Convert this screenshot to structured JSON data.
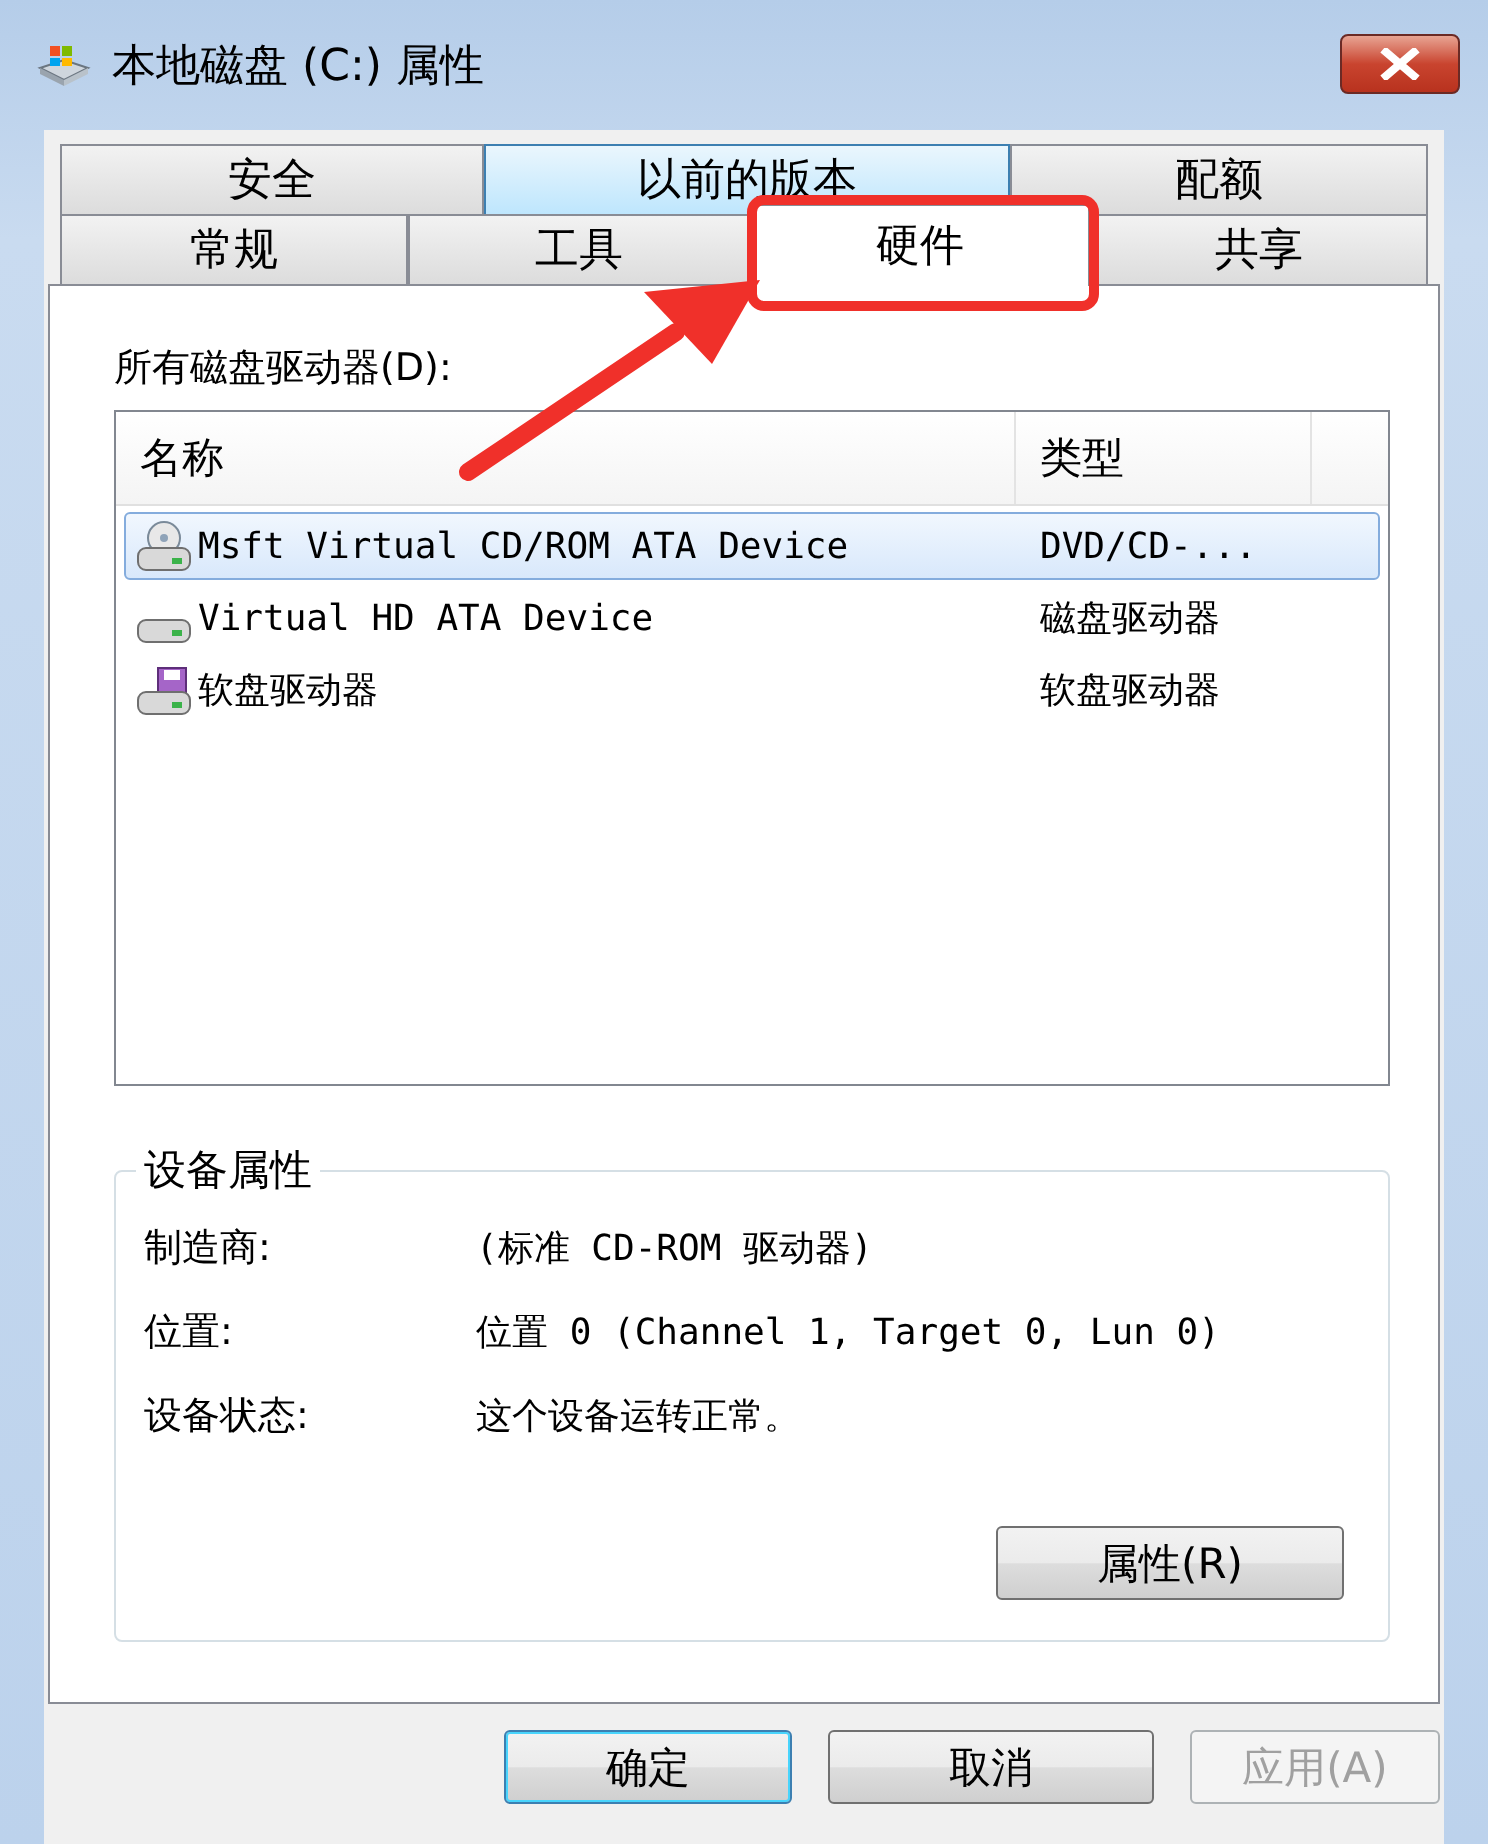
{
  "window": {
    "title": "本地磁盘 (C:) 属性"
  },
  "tab_rows": [
    [
      {
        "label": "安全",
        "selected": false,
        "hover": false
      },
      {
        "label": "以前的版本",
        "selected": false,
        "hover": true
      },
      {
        "label": "配额",
        "selected": false,
        "hover": false
      }
    ],
    [
      {
        "label": "常规",
        "selected": false,
        "hover": false
      },
      {
        "label": "工具",
        "selected": false,
        "hover": false
      },
      {
        "label": "硬件",
        "selected": true,
        "hover": false
      },
      {
        "label": "共享",
        "selected": false,
        "hover": false
      }
    ]
  ],
  "drives_label": "所有磁盘驱动器(D):",
  "table": {
    "columns": [
      "名称",
      "类型"
    ],
    "rows": [
      {
        "kind": "cd",
        "name": "Msft Virtual CD/ROM ATA Device",
        "type": "DVD/CD-...",
        "selected": true
      },
      {
        "kind": "disk",
        "name": "Virtual HD ATA Device",
        "type": "磁盘驱动器",
        "selected": false
      },
      {
        "kind": "floppy",
        "name": "软盘驱动器",
        "type": "软盘驱动器",
        "selected": false
      }
    ]
  },
  "device_properties": {
    "title": "设备属性",
    "fields": [
      {
        "label": "制造商:",
        "value": "(标准 CD-ROM 驱动器)"
      },
      {
        "label": "位置:",
        "value": "位置 0 (Channel 1, Target 0, Lun 0)"
      },
      {
        "label": "设备状态:",
        "value": "这个设备运转正常。"
      }
    ],
    "button": "属性(R)"
  },
  "buttons": [
    {
      "label": "确定",
      "default": true,
      "disabled": false
    },
    {
      "label": "取消",
      "default": false,
      "disabled": false
    },
    {
      "label": "应用(A)",
      "default": false,
      "disabled": true
    }
  ]
}
